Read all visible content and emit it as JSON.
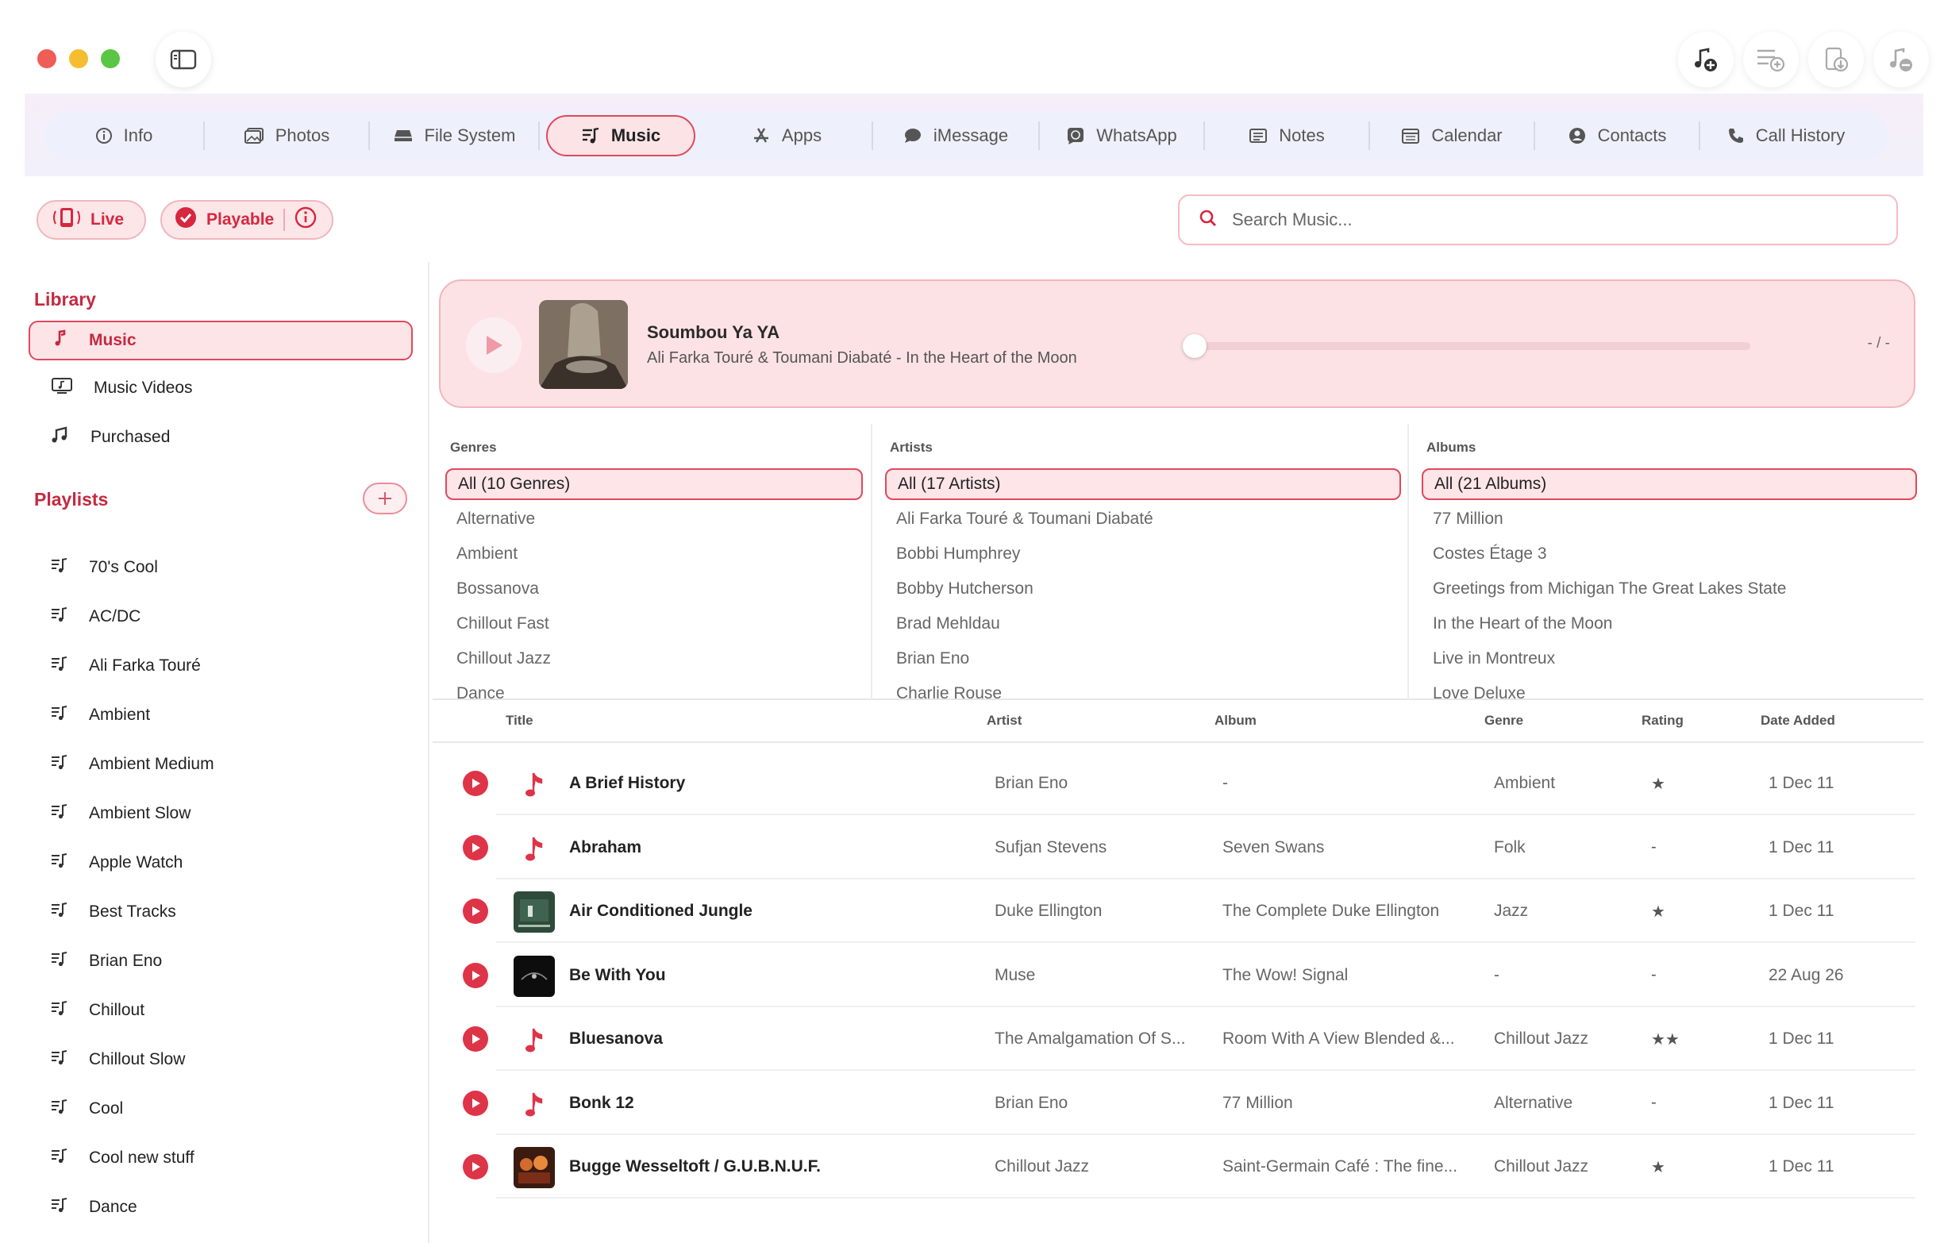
{
  "window": {
    "toolbar_icons": [
      "add-music-icon",
      "add-to-playlist-icon",
      "export-to-device-icon",
      "remove-music-icon"
    ]
  },
  "tabs": [
    {
      "label": "Info",
      "icon": "info-icon"
    },
    {
      "label": "Photos",
      "icon": "photos-icon"
    },
    {
      "label": "File System",
      "icon": "drive-icon"
    },
    {
      "label": "Music",
      "icon": "music-list-icon",
      "active": true
    },
    {
      "label": "Apps",
      "icon": "apps-icon"
    },
    {
      "label": "iMessage",
      "icon": "message-bubble-icon"
    },
    {
      "label": "WhatsApp",
      "icon": "whatsapp-icon"
    },
    {
      "label": "Notes",
      "icon": "notes-icon"
    },
    {
      "label": "Calendar",
      "icon": "calendar-icon"
    },
    {
      "label": "Contacts",
      "icon": "contacts-icon"
    },
    {
      "label": "Call History",
      "icon": "phone-icon"
    }
  ],
  "badges": {
    "live": "Live",
    "playable": "Playable"
  },
  "search": {
    "placeholder": "Search Music..."
  },
  "sidebar": {
    "library_title": "Library",
    "library": [
      {
        "label": "Music",
        "icon": "music-note-icon",
        "active": true
      },
      {
        "label": "Music Videos",
        "icon": "music-video-icon"
      },
      {
        "label": "Purchased",
        "icon": "music-notes-icon"
      }
    ],
    "playlists_title": "Playlists",
    "playlists": [
      "70's Cool",
      "AC/DC",
      "Ali Farka Touré",
      "Ambient",
      "Ambient Medium",
      "Ambient Slow",
      "Apple Watch",
      "Best Tracks",
      "Brian Eno",
      "Chillout",
      "Chillout Slow",
      "Cool",
      "Cool new stuff",
      "Dance"
    ]
  },
  "player": {
    "title": "Soumbou Ya YA",
    "subtitle": "Ali Farka Touré & Toumani Diabaté - In the Heart of the Moon",
    "time": "- / -",
    "progress": 0.0
  },
  "browser": {
    "genres": {
      "header": "Genres",
      "items": [
        "All (10 Genres)",
        "Alternative",
        "Ambient",
        "Bossanova",
        "Chillout Fast",
        "Chillout Jazz",
        "Dance"
      ]
    },
    "artists": {
      "header": "Artists",
      "items": [
        "All (17 Artists)",
        "Ali Farka Touré & Toumani Diabaté",
        "Bobbi Humphrey",
        "Bobby Hutcherson",
        "Brad Mehldau",
        "Brian Eno",
        "Charlie Rouse"
      ]
    },
    "albums": {
      "header": "Albums",
      "items": [
        "All (21 Albums)",
        "77 Million",
        "Costes Étage 3",
        "Greetings from Michigan The Great Lakes State",
        "In the Heart of the Moon",
        "Live in Montreux",
        "Love Deluxe"
      ]
    }
  },
  "table": {
    "headers": {
      "title": "Title",
      "artist": "Artist",
      "album": "Album",
      "genre": "Genre",
      "rating": "Rating",
      "date": "Date Added"
    },
    "rows": [
      {
        "title": "A Brief History",
        "artist": "Brian Eno",
        "album": "-",
        "genre": "Ambient",
        "rating": "★",
        "date": "1 Dec 11",
        "art": "note"
      },
      {
        "title": "Abraham",
        "artist": "Sufjan Stevens",
        "album": "Seven Swans",
        "genre": "Folk",
        "rating": "-",
        "date": "1 Dec 11",
        "art": "note"
      },
      {
        "title": "Air Conditioned Jungle",
        "artist": "Duke Ellington",
        "album": "The Complete Duke Ellington",
        "genre": "Jazz",
        "rating": "★",
        "date": "1 Dec 11",
        "art": "green"
      },
      {
        "title": "Be With You",
        "artist": "Muse",
        "album": "The Wow! Signal",
        "genre": "-",
        "rating": "-",
        "date": "22 Aug 26",
        "art": "dark"
      },
      {
        "title": "Bluesanova",
        "artist": "The Amalgamation Of S...",
        "album": "Room With A View Blended &...",
        "genre": "Chillout Jazz",
        "rating": "★★",
        "date": "1 Dec 11",
        "art": "note"
      },
      {
        "title": "Bonk 12",
        "artist": "Brian Eno",
        "album": "77 Million",
        "genre": "Alternative",
        "rating": "-",
        "date": "1 Dec 11",
        "art": "note"
      },
      {
        "title": "Bugge Wesseltoft / G.U.B.N.U.F.",
        "artist": "Chillout Jazz",
        "album": "Saint-Germain Café : The fine...",
        "genre": "Chillout Jazz",
        "rating": "★",
        "date": "1 Dec 11",
        "art": "orange"
      }
    ]
  }
}
